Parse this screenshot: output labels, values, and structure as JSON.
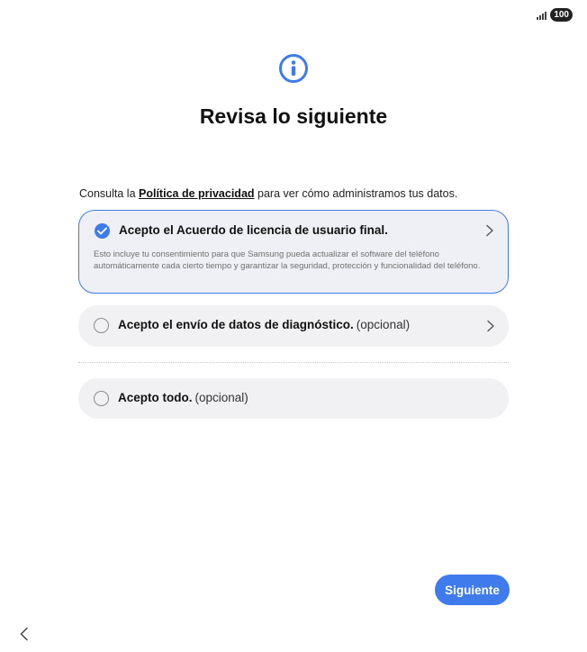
{
  "status_bar": {
    "battery": "100",
    "signal_icon": "signal-bars-icon"
  },
  "header": {
    "icon": "info-icon",
    "title": "Revisa lo siguiente"
  },
  "privacy": {
    "prefix": "Consulta la ",
    "link": "Política de privacidad",
    "suffix": " para ver cómo administramos tus datos."
  },
  "options": [
    {
      "label": "Acepto el Acuerdo de licencia de usuario final.",
      "checked": true,
      "description": "Esto incluye tu consentimiento para que Samsung pueda actualizar el software del teléfono automáticamente cada cierto tiempo y garantizar la seguridad, protección y funcionalidad del teléfono."
    },
    {
      "label": "Acepto el envío de datos de diagnóstico.",
      "optional": "(opcional)",
      "checked": false
    },
    {
      "label": "Acepto todo.",
      "optional": "(opcional)",
      "checked": false
    }
  ],
  "buttons": {
    "next": "Siguiente",
    "back_icon": "chevron-left-icon"
  },
  "colors": {
    "accent": "#3f7bea",
    "card_background": "#f1f1f3"
  }
}
